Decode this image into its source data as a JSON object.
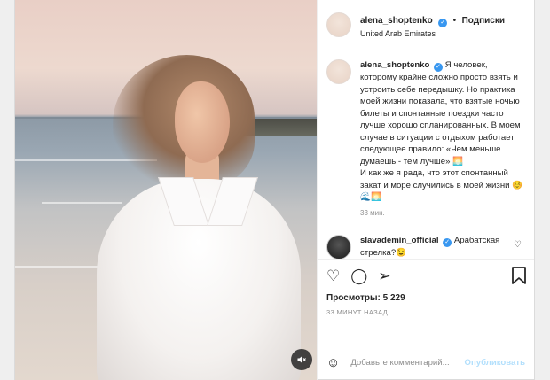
{
  "post": {
    "username": "alena_shoptenko",
    "verified_badge": "✓",
    "dot": "•",
    "follow_label": "Подписки",
    "location": "United Arab Emirates",
    "caption_user": "alena_shoptenko",
    "caption": "Я человек, которому крайне сложно просто взять и устроить себе передышку. Но практика моей жизни показала, что взятые ночью билеты и спонтанные поездки часто лучше хорошо спланированных. В моем случае в ситуации с отдыхом работает следующее правило: «Чем меньше думаешь - тем лучше» 🌅\nИ как же я рада, что этот спонтанный закат и море случились в моей жизни ☺️🌊🌅",
    "caption_time": "33 мин.",
    "comment": {
      "username": "slavademin_official",
      "text": "Арабатская стрелка?😉"
    },
    "views": "Просмотры: 5 229",
    "timestamp": "33 МИНУТ НАЗАД",
    "add_comment_placeholder": "Добавьте комментарий...",
    "publish_label": "Опубликовать"
  },
  "icons": {
    "heart": "♡",
    "comment": "◯",
    "share": "➢",
    "bookmark": "⛉",
    "emoji": "☺",
    "mute": "🔇"
  }
}
